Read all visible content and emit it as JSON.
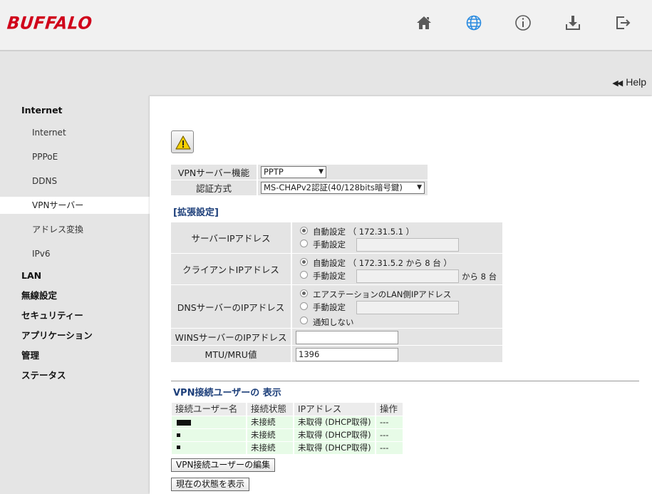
{
  "brand": {
    "logo_text": "BUFFALO",
    "logo_color": "#d0021b"
  },
  "header": {
    "icons": [
      {
        "name": "home-icon"
      },
      {
        "name": "globe-icon",
        "color": "#2a8be0"
      },
      {
        "name": "info-icon"
      },
      {
        "name": "download-icon"
      },
      {
        "name": "logout-icon"
      }
    ]
  },
  "help": {
    "label": "Help",
    "arrows": "◀◀"
  },
  "sidebar": {
    "items": [
      {
        "label": "Internet",
        "level": "main"
      },
      {
        "label": "Internet",
        "level": "sub"
      },
      {
        "label": "PPPoE",
        "level": "sub"
      },
      {
        "label": "DDNS",
        "level": "sub"
      },
      {
        "label": "VPNサーバー",
        "level": "sub",
        "active": true
      },
      {
        "label": "アドレス変換",
        "level": "sub"
      },
      {
        "label": "IPv6",
        "level": "sub"
      },
      {
        "label": "LAN",
        "level": "main"
      },
      {
        "label": "無線設定",
        "level": "main"
      },
      {
        "label": "セキュリティー",
        "level": "main"
      },
      {
        "label": "アプリケーション",
        "level": "main"
      },
      {
        "label": "管理",
        "level": "main"
      },
      {
        "label": "ステータス",
        "level": "main"
      }
    ]
  },
  "warning": {
    "icon": "warning-icon"
  },
  "basic": {
    "vpn_server_label": "VPNサーバー機能",
    "vpn_server_value": "PPTP",
    "auth_label": "認証方式",
    "auth_value": "MS-CHAPv2認証(40/128bits暗号鍵)"
  },
  "advanced": {
    "heading": "[拡張設定]",
    "server_ip": {
      "label": "サーバーIPアドレス",
      "auto_label": "自動設定 （ 172.31.5.1 ）",
      "manual_label": "手動設定",
      "selected": "auto"
    },
    "client_ip": {
      "label": "クライアントIPアドレス",
      "auto_label": "自動設定 （ 172.31.5.2 から 8 台 ）",
      "manual_label": "手動設定",
      "suffix": "から 8 台",
      "selected": "auto"
    },
    "dns_ip": {
      "label": "DNSサーバーのIPアドレス",
      "option1": "エアステーションのLAN側IPアドレス",
      "option2": "手動設定",
      "option3": "通知しない",
      "selected": "option1"
    },
    "wins_ip": {
      "label": "WINSサーバーのIPアドレス",
      "value": ""
    },
    "mtu": {
      "label": "MTU/MRU値",
      "value": "1396"
    }
  },
  "users": {
    "heading": "VPN接続ユーザーの 表示",
    "columns": [
      "接続ユーザー名",
      "接続状態",
      "IPアドレス",
      "操作"
    ],
    "rows": [
      {
        "status": "未接続",
        "ip": "未取得 (DHCP取得)",
        "action": "---"
      },
      {
        "status": "未接続",
        "ip": "未取得 (DHCP取得)",
        "action": "---"
      },
      {
        "status": "未接続",
        "ip": "未取得 (DHCP取得)",
        "action": "---"
      }
    ],
    "edit_button": "VPN接続ユーザーの編集",
    "refresh_button": "現在の状態を表示"
  }
}
